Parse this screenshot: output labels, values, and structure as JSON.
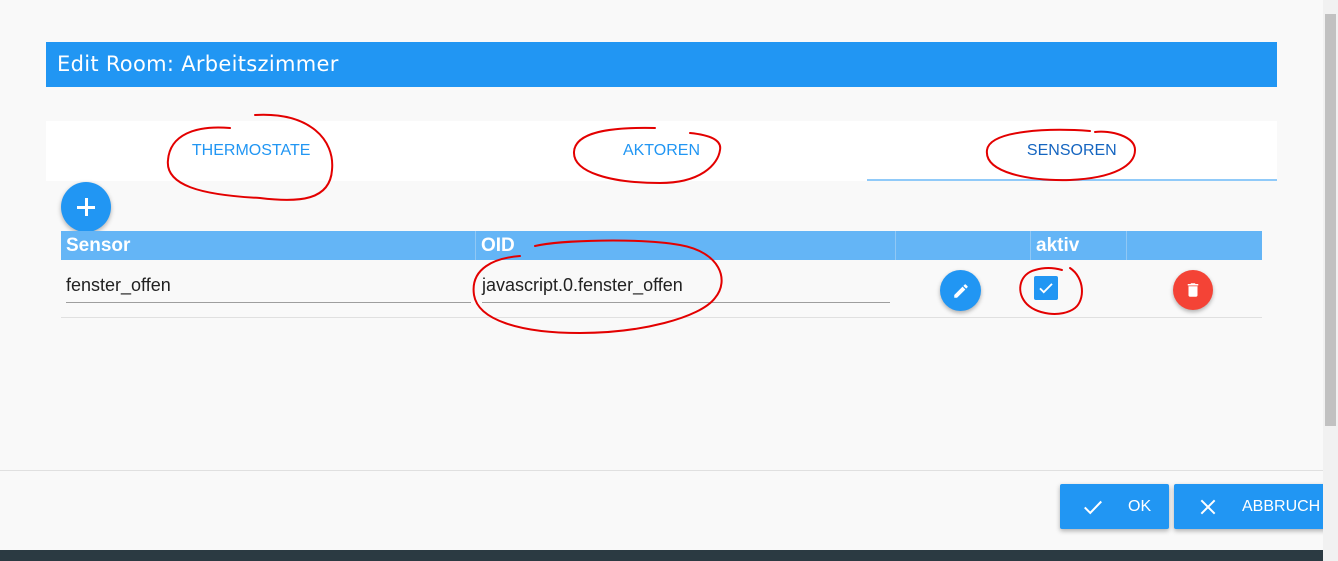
{
  "dialog": {
    "title": "Edit Room: Arbeitszimmer"
  },
  "tabs": [
    {
      "label": "THERMOSTATE",
      "active": false
    },
    {
      "label": "AKTOREN",
      "active": false
    },
    {
      "label": "SENSOREN",
      "active": true
    }
  ],
  "add_button": {
    "icon": "plus-icon"
  },
  "table": {
    "headers": [
      "Sensor",
      "OID",
      "",
      "aktiv",
      ""
    ],
    "rows": [
      {
        "sensor": "fenster_offen",
        "oid": "javascript.0.fenster_offen",
        "aktiv": true
      }
    ]
  },
  "footer": {
    "ok_label": "OK",
    "cancel_label": "ABBRUCH"
  },
  "colors": {
    "primary": "#2196f3",
    "header": "#64b5f6",
    "danger": "#f44336",
    "annotation": "#e30000"
  }
}
